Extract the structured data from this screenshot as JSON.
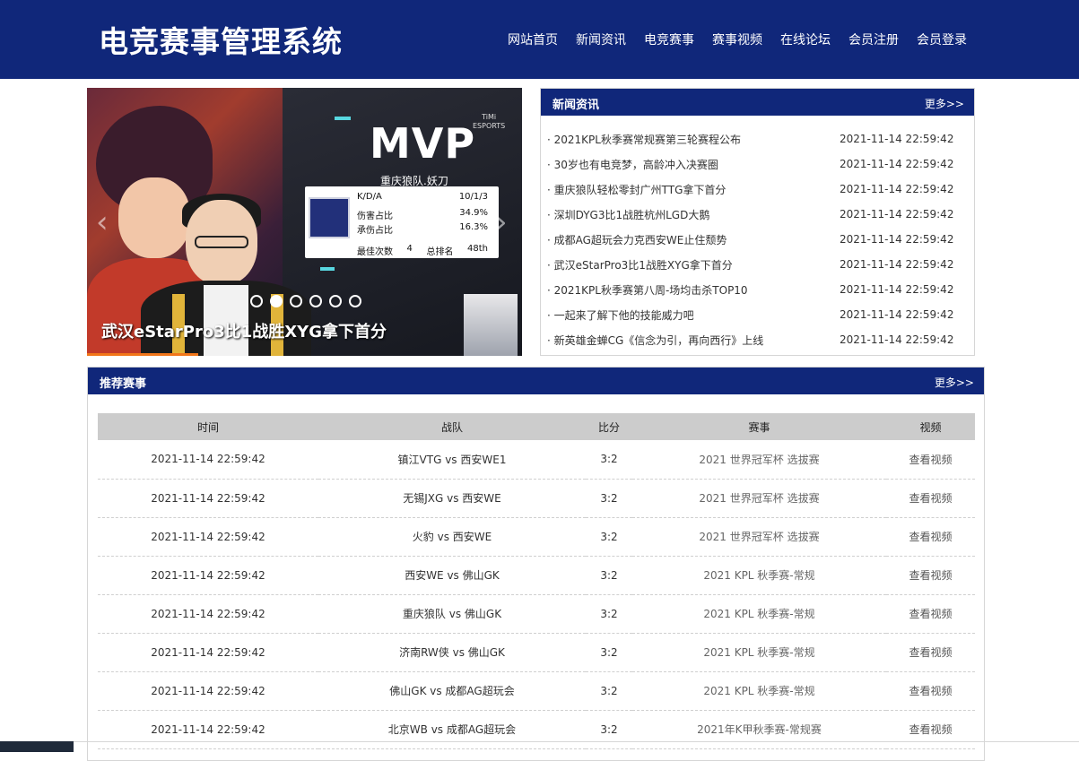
{
  "header": {
    "title": "电竞赛事管理系统",
    "nav": [
      "网站首页",
      "新闻资讯",
      "电竞赛事",
      "赛事视频",
      "在线论坛",
      "会员注册",
      "会员登录"
    ]
  },
  "carousel": {
    "caption": "武汉eStarPro3比1战胜XYG拿下首分",
    "slide_count": 6,
    "active_index": 1,
    "prev_icon": "chevron-left-icon",
    "next_icon": "chevron-right-icon",
    "slide": {
      "mvp": "MVP",
      "player": "重庆狼队.妖刀",
      "esports_logo_text": "TiMi\nESPORTS",
      "stats": [
        {
          "label": "K/D/A",
          "value": "10/1/3"
        },
        {
          "label": "伤害占比",
          "value": "34.9%"
        },
        {
          "label": "承伤占比",
          "value": "16.3%"
        }
      ],
      "foot": {
        "label1": "最佳次数",
        "value1": "4",
        "label2": "总排名",
        "value2": "48th"
      }
    }
  },
  "news": {
    "title": "新闻资讯",
    "more": "更多>>",
    "items": [
      {
        "title": "· 2021KPL秋季赛常规赛第三轮赛程公布",
        "time": "2021-11-14 22:59:42"
      },
      {
        "title": "·  30岁也有电竞梦，高龄冲入决赛圈",
        "time": "2021-11-14 22:59:42"
      },
      {
        "title": "· 重庆狼队轻松零封广州TTG拿下首分",
        "time": "2021-11-14 22:59:42"
      },
      {
        "title": "· 深圳DYG3比1战胜杭州LGD大鹅",
        "time": "2021-11-14 22:59:42"
      },
      {
        "title": "· 成都AG超玩会力克西安WE止住颓势",
        "time": "2021-11-14 22:59:42"
      },
      {
        "title": "· 武汉eStarPro3比1战胜XYG拿下首分",
        "time": "2021-11-14 22:59:42"
      },
      {
        "title": "· 2021KPL秋季赛第八周-场均击杀TOP10",
        "time": "2021-11-14 22:59:42"
      },
      {
        "title": "· 一起来了解下他的技能威力吧",
        "time": "2021-11-14 22:59:42"
      },
      {
        "title": "· 新英雄金蝉CG《信念为引，再向西行》上线",
        "time": "2021-11-14 22:59:42"
      }
    ]
  },
  "matches": {
    "title": "推荐赛事",
    "more": "更多>>",
    "columns": [
      "时间",
      "战队",
      "比分",
      "赛事",
      "视频"
    ],
    "rows": [
      {
        "time": "2021-11-14 22:59:42",
        "teams": "镇江VTG vs 西安WE1",
        "score": "3:2",
        "event": "2021 世界冠军杯 选拔赛",
        "video": "查看视频"
      },
      {
        "time": "2021-11-14 22:59:42",
        "teams": "无锡JXG vs 西安WE",
        "score": "3:2",
        "event": "2021 世界冠军杯 选拔赛",
        "video": "查看视频"
      },
      {
        "time": "2021-11-14 22:59:42",
        "teams": "火豹 vs 西安WE",
        "score": "3:2",
        "event": "2021 世界冠军杯 选拔赛",
        "video": "查看视频"
      },
      {
        "time": "2021-11-14 22:59:42",
        "teams": "西安WE vs 佛山GK",
        "score": "3:2",
        "event": "2021 KPL 秋季赛-常规",
        "video": "查看视频"
      },
      {
        "time": "2021-11-14 22:59:42",
        "teams": "重庆狼队 vs 佛山GK",
        "score": "3:2",
        "event": "2021 KPL 秋季赛-常规",
        "video": "查看视频"
      },
      {
        "time": "2021-11-14 22:59:42",
        "teams": "济南RW侠 vs 佛山GK",
        "score": "3:2",
        "event": "2021 KPL 秋季赛-常规",
        "video": "查看视频"
      },
      {
        "time": "2021-11-14 22:59:42",
        "teams": "佛山GK vs 成都AG超玩会",
        "score": "3:2",
        "event": "2021 KPL 秋季赛-常规",
        "video": "查看视频"
      },
      {
        "time": "2021-11-14 22:59:42",
        "teams": "北京WB vs 成都AG超玩会",
        "score": "3:2",
        "event": "2021年K甲秋季赛-常规赛",
        "video": "查看视频"
      }
    ]
  },
  "colors": {
    "brand": "#10277a",
    "table_header": "#cccccc",
    "caption_underline": "#f2761a"
  }
}
